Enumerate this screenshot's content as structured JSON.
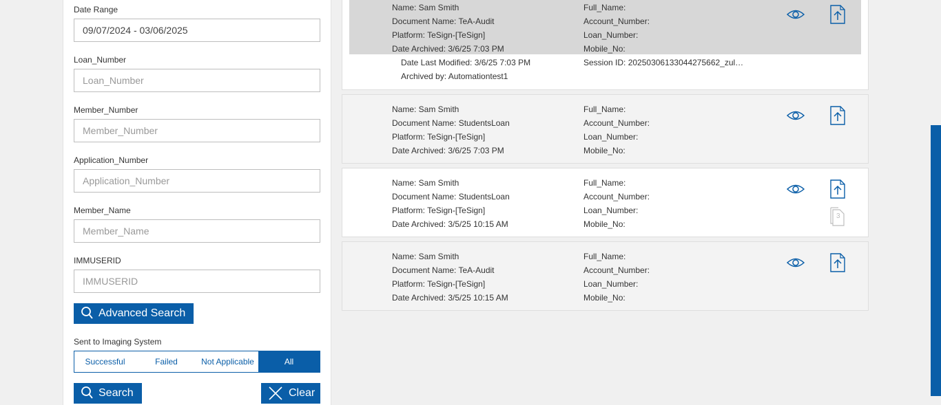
{
  "filters": {
    "date_range": {
      "label": "Date Range",
      "value": "09/07/2024 - 03/06/2025"
    },
    "loan_number": {
      "label": "Loan_Number",
      "placeholder": "Loan_Number"
    },
    "member_number": {
      "label": "Member_Number",
      "placeholder": "Member_Number"
    },
    "application_number": {
      "label": "Application_Number",
      "placeholder": "Application_Number"
    },
    "member_name": {
      "label": "Member_Name",
      "placeholder": "Member_Name"
    },
    "immuserid": {
      "label": "IMMUSERID",
      "placeholder": "IMMUSERID"
    },
    "advanced_search_label": "Advanced Search",
    "sent_to_imaging": {
      "label": "Sent to Imaging System",
      "options": [
        "Successful",
        "Failed",
        "Not Applicable",
        "All"
      ],
      "selected": "All"
    },
    "search_label": "Search",
    "clear_label": "Clear"
  },
  "records": [
    {
      "name": "Name: Sam Smith",
      "document": "Document Name: TeA-Audit",
      "platform": "Platform: TeSign-[TeSign]",
      "archived": "Date Archived: 3/6/25 7:03 PM",
      "full_name": "Full_Name:",
      "account_number": "Account_Number:",
      "loan_number": "Loan_Number:",
      "mobile_no": "Mobile_No:",
      "date_last_modified": "Date Last Modified: 3/6/25 7:03 PM",
      "archived_by": "Archived by: Automationtest1",
      "session_id": "Session ID: 20250306133044275662_zul…"
    },
    {
      "name": "Name: Sam Smith",
      "document": "Document Name: StudentsLoan",
      "platform": "Platform: TeSign-[TeSign]",
      "archived": "Date Archived: 3/6/25 7:03 PM",
      "full_name": "Full_Name:",
      "account_number": "Account_Number:",
      "loan_number": "Loan_Number:",
      "mobile_no": "Mobile_No:"
    },
    {
      "name": "Name: Sam Smith",
      "document": "Document Name: StudentsLoan",
      "platform": "Platform: TeSign-[TeSign]",
      "archived": "Date Archived: 3/5/25 10:15 AM",
      "full_name": "Full_Name:",
      "account_number": "Account_Number:",
      "loan_number": "Loan_Number:",
      "mobile_no": "Mobile_No:",
      "page_count": "3"
    },
    {
      "name": "Name: Sam Smith",
      "document": "Document Name: TeA-Audit",
      "platform": "Platform: TeSign-[TeSign]",
      "archived": "Date Archived: 3/5/25 10:15 AM",
      "full_name": "Full_Name:",
      "account_number": "Account_Number:",
      "loan_number": "Loan_Number:",
      "mobile_no": "Mobile_No:"
    }
  ],
  "icons": {
    "view": "eye-icon",
    "upload": "upload-document-icon",
    "pages": "document-pages-icon",
    "search": "search-icon",
    "clear": "close-icon"
  },
  "colors": {
    "accent": "#0a5ea8",
    "selected_row": "#d7d7d7",
    "alt_row": "#f3f3f3"
  }
}
